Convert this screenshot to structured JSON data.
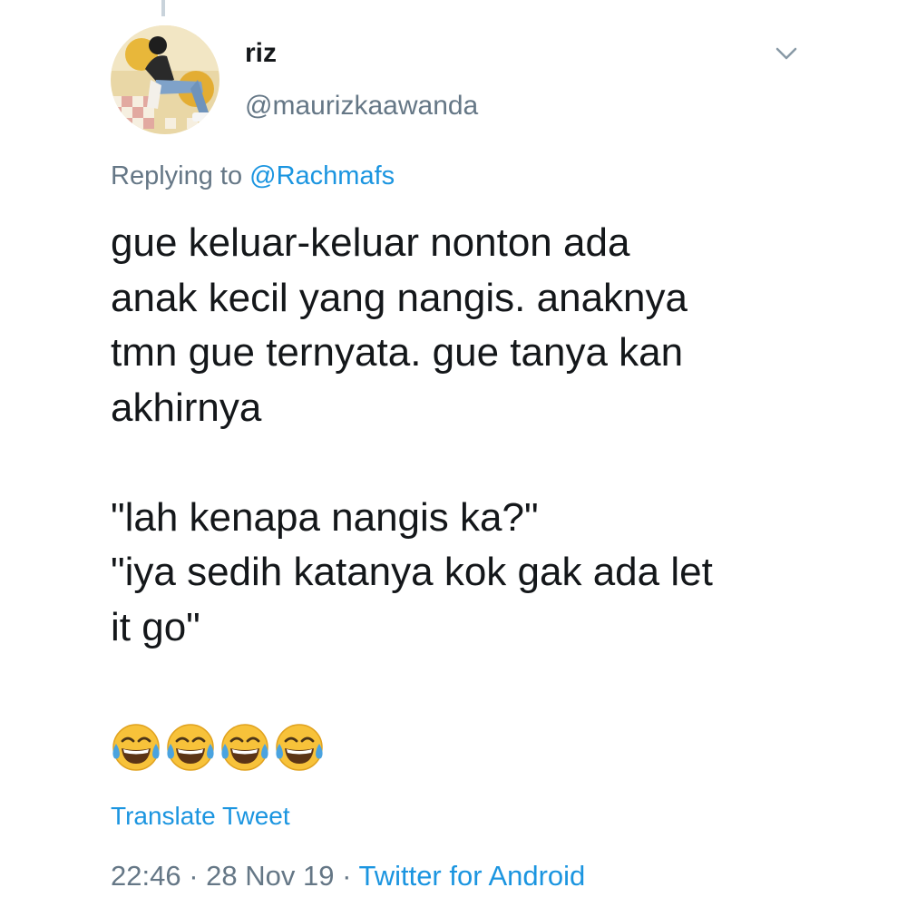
{
  "tweet": {
    "display_name": "riz",
    "handle": "@maurizkaawanda",
    "replying_prefix": "Replying to",
    "replying_to": "@Rachmafs",
    "text": "gue keluar-keluar nonton ada\nanak kecil yang nangis. anaknya\ntmn gue ternyata. gue tanya kan\nakhirnya\n\n\"lah kenapa nangis ka?\"\n\"iya sedih katanya kok gak ada let\nit go\"",
    "emojis": [
      "face-with-tears-of-joy",
      "face-with-tears-of-joy",
      "face-with-tears-of-joy",
      "face-with-tears-of-joy"
    ],
    "translate_label": "Translate Tweet",
    "time": "22:46",
    "separator": " · ",
    "date": "28 Nov 19",
    "source": "Twitter for Android"
  },
  "icons": {
    "caret": "chevron-down-icon",
    "avatar": "avatar"
  },
  "colors": {
    "link": "#1b95e0",
    "secondary_text": "#657786",
    "primary_text": "#14171a",
    "background": "#ffffff"
  }
}
